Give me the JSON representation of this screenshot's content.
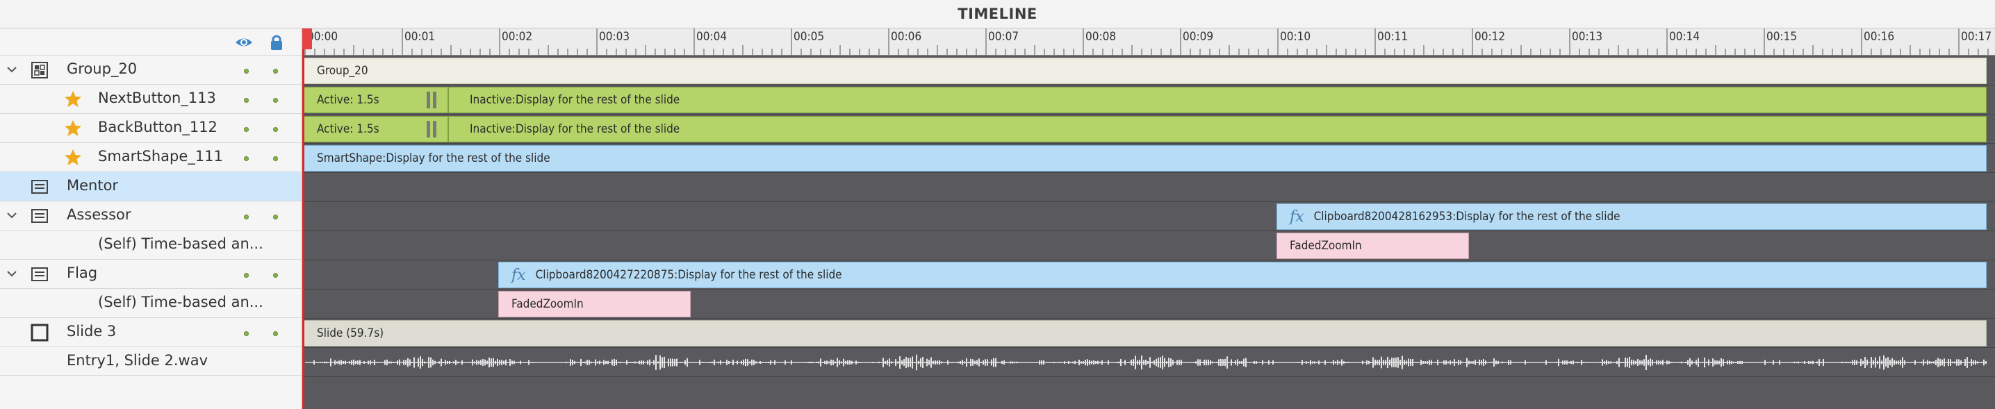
{
  "panel_title": "TIMELINE",
  "colors": {
    "accent_red": "#e02525",
    "green_bar": "#b4d46a",
    "blue_bar": "#b6dcf6",
    "pink_bar": "#f8d5de",
    "dot_green": "#87b24e"
  },
  "header": {
    "visibility_icon": "eye-icon",
    "lock_icon": "lock-icon"
  },
  "ruler": {
    "labels": [
      "00:00",
      "00:01",
      "00:02",
      "00:03",
      "00:04",
      "00:05",
      "00:06",
      "00:07",
      "00:08",
      "00:09",
      "00:10",
      "00:11",
      "00:12",
      "00:13",
      "00:14",
      "00:15",
      "00:16",
      "00:17"
    ]
  },
  "layers": [
    {
      "label": "Group_20",
      "icon": "group-icon",
      "expanded": true
    },
    {
      "label": "NextButton_113",
      "icon": "star-icon"
    },
    {
      "label": "BackButton_112",
      "icon": "star-icon"
    },
    {
      "label": "SmartShape_111",
      "icon": "star-icon"
    },
    {
      "label": "Mentor",
      "icon": "slide-object-icon",
      "selected": true
    },
    {
      "label": "Assessor",
      "icon": "slide-object-icon",
      "expanded": true
    },
    {
      "label": "(Self) Time-based an..."
    },
    {
      "label": "Flag",
      "icon": "slide-object-icon",
      "expanded": true
    },
    {
      "label": "(Self) Time-based an..."
    },
    {
      "label": "Slide 3",
      "icon": "slide-icon"
    },
    {
      "label": "Entry1, Slide 2.wav"
    }
  ],
  "tracks": {
    "group": "Group_20",
    "next_active": "Active: 1.5s",
    "next_inactive": "Inactive:Display for the rest of the slide",
    "back_active": "Active: 1.5s",
    "back_inactive": "Inactive:Display for the rest of the slide",
    "smartshape": "SmartShape:Display for the rest of the slide",
    "assessor_fx": "fx",
    "assessor": "Clipboard8200428162953:Display for the rest of the slide",
    "assessor_effect": "FadedZoomIn",
    "flag_fx": "fx",
    "flag": "Clipboard8200427220875:Display for the rest of the slide",
    "flag_effect": "FadedZoomIn",
    "slide": "Slide (59.7s)"
  }
}
